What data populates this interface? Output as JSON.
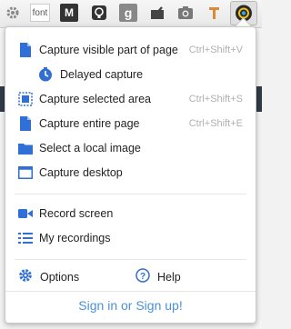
{
  "toolbar": {
    "font_icon_label": "font",
    "mail_icon_label": "M",
    "g_icon_label": "g"
  },
  "menu": {
    "capture_visible": {
      "label": "Capture visible part of page",
      "shortcut": "Ctrl+Shift+V"
    },
    "delayed_capture": {
      "label": "Delayed capture"
    },
    "capture_area": {
      "label": "Capture selected area",
      "shortcut": "Ctrl+Shift+S"
    },
    "capture_entire": {
      "label": "Capture entire page",
      "shortcut": "Ctrl+Shift+E"
    },
    "select_local": {
      "label": "Select a local image"
    },
    "capture_desktop": {
      "label": "Capture desktop"
    },
    "record_screen": {
      "label": "Record screen"
    },
    "my_recordings": {
      "label": "My recordings"
    },
    "options": {
      "label": "Options"
    },
    "help": {
      "label": "Help"
    },
    "signin": "Sign in or Sign up!"
  },
  "colors": {
    "accent": "#2f6fd6",
    "link": "#4a90d9"
  }
}
